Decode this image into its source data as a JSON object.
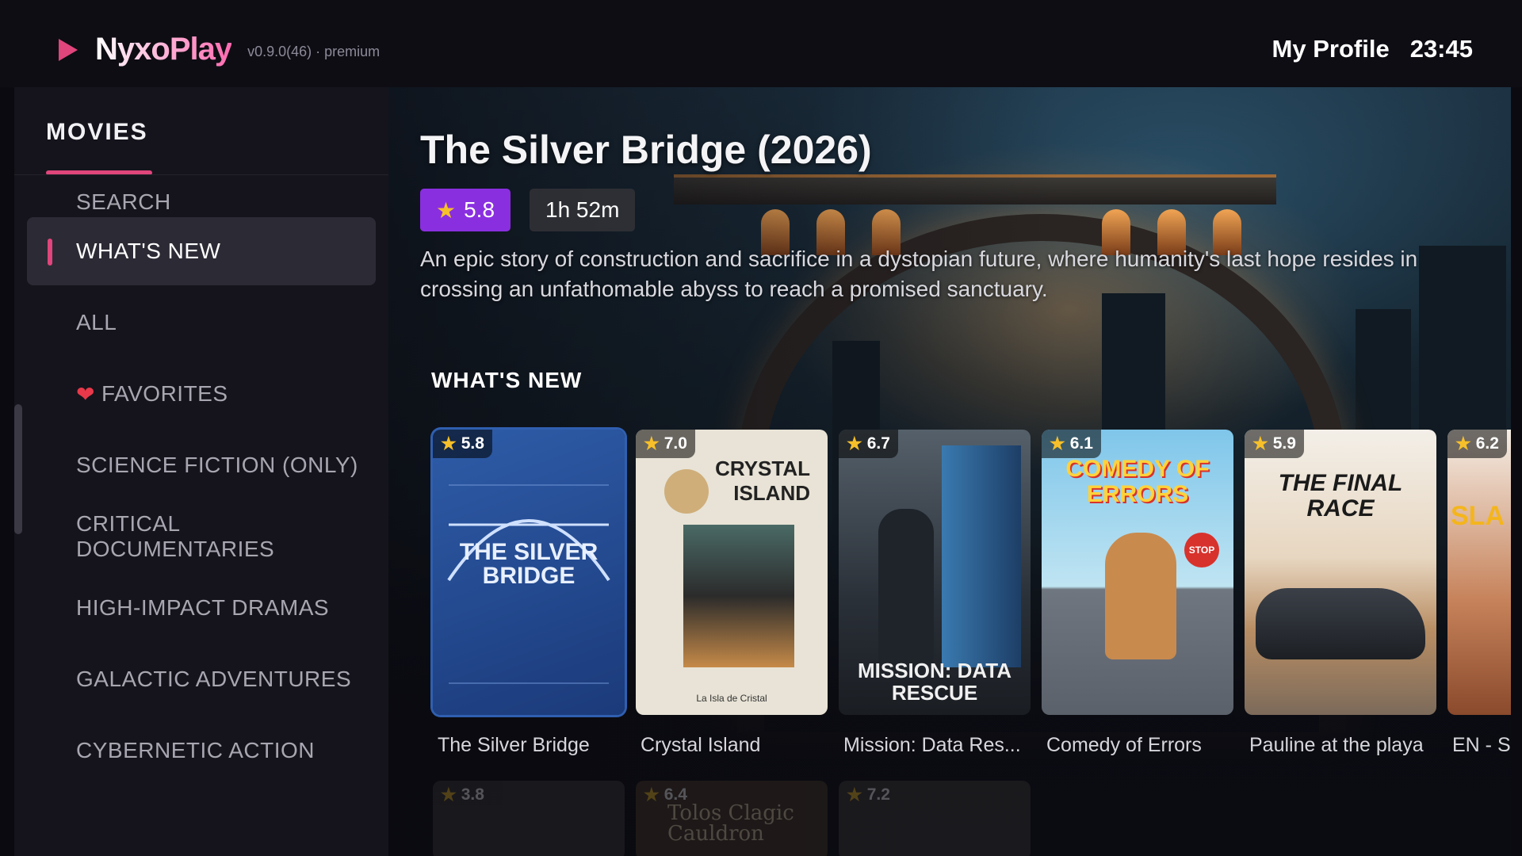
{
  "header": {
    "app_name": "NyxoPlay",
    "version": "v0.9.0(46) · premium",
    "profile_label": "My Profile",
    "clock": "23:45"
  },
  "sidebar": {
    "section_title": "MOVIES",
    "items": [
      {
        "label": "SEARCH"
      },
      {
        "label": "WHAT'S NEW",
        "active": true
      },
      {
        "label": "ALL"
      },
      {
        "label": "FAVORITES",
        "icon": "heart-icon"
      },
      {
        "label": "SCIENCE FICTION (ONLY)"
      },
      {
        "label": "CRITICAL DOCUMENTARIES"
      },
      {
        "label": "HIGH-IMPACT DRAMAS"
      },
      {
        "label": "GALACTIC ADVENTURES"
      },
      {
        "label": "CYBERNETIC ACTION"
      }
    ]
  },
  "hero": {
    "title": "The Silver Bridge (2026)",
    "rating": "5.8",
    "duration": "1h 52m",
    "description": "An epic story of construction and sacrifice in a dystopian future, where humanity's last hope resides in crossing an unfathomable abyss to reach a promised sanctuary."
  },
  "row": {
    "title": "WHAT'S NEW",
    "cards": [
      {
        "rating": "5.8",
        "title": "The Silver Bridge",
        "poster_text": "THE SILVER BRIDGE"
      },
      {
        "rating": "7.0",
        "title": "Crystal Island",
        "poster_text": "CRYSTAL ISLAND",
        "poster_subtext": "La Isla de Cristal"
      },
      {
        "rating": "6.7",
        "title": "Mission: Data Res...",
        "poster_text": "MISSION: DATA RESCUE"
      },
      {
        "rating": "6.1",
        "title": "Comedy of Errors",
        "poster_text": "COMEDY OF ERRORS",
        "poster_subtext": "STOP"
      },
      {
        "rating": "5.9",
        "title": "Pauline at the playa",
        "poster_text": "THE FINAL RACE"
      },
      {
        "rating": "6.2",
        "title": "EN - SI",
        "poster_text": "SLA"
      }
    ],
    "next_ratings": [
      "3.8",
      "6.4",
      "7.2"
    ],
    "next_poster_text": "Tolos Clagic Cauldron"
  },
  "colors": {
    "accent": "#e0457b",
    "rating_badge": "#8a2fe0",
    "star": "#f7c02a",
    "heart": "#e8394a"
  }
}
